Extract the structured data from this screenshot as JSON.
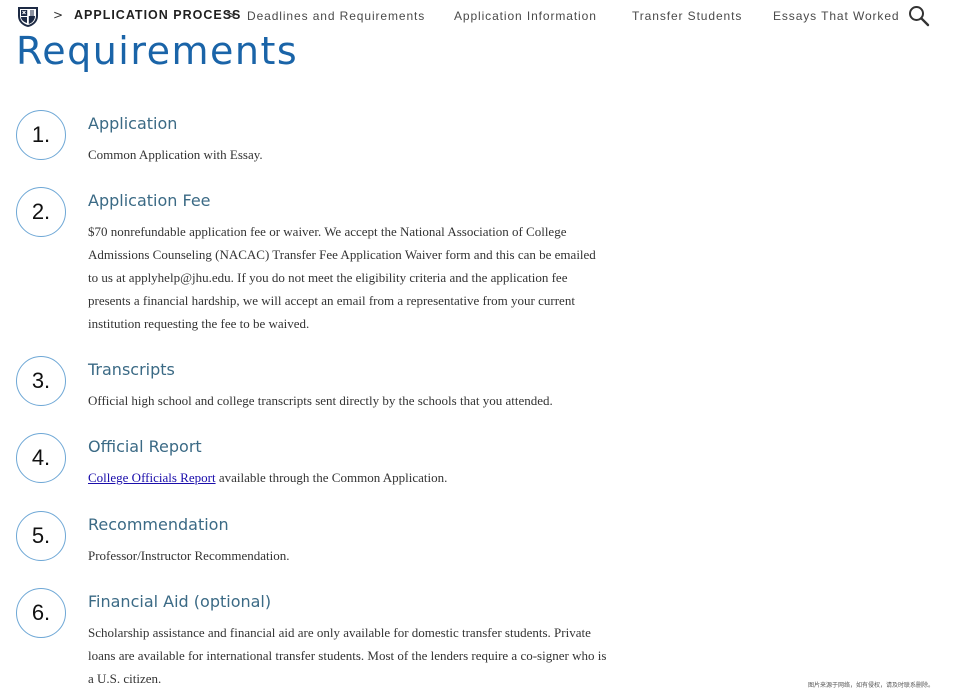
{
  "nav": {
    "current": "APPLICATION PROCESS",
    "links": [
      "Deadlines and Requirements",
      "Application Information",
      "Transfer Students",
      "Essays That Worked"
    ]
  },
  "page": {
    "title": "Requirements"
  },
  "steps": [
    {
      "number": "1.",
      "title": "Application",
      "body": "Common Application with Essay."
    },
    {
      "number": "2.",
      "title": "Application Fee",
      "body": "$70 nonrefundable application fee or waiver. We accept the National Association of College Admissions Counseling (NACAC) Transfer Fee Application Waiver form and this can be emailed to us at applyhelp@jhu.edu. If you do not meet the eligibility criteria and the application fee presents a financial hardship, we will accept an email from a representative from your current institution requesting the fee to be waived."
    },
    {
      "number": "3.",
      "title": "Transcripts",
      "body": "Official high school and college transcripts sent directly by the schools that you attended."
    },
    {
      "number": "4.",
      "title": "Official Report",
      "link": "College Officials Report",
      "body": " available through the Common Application."
    },
    {
      "number": "5.",
      "title": "Recommendation",
      "body": "Professor/Instructor Recommendation."
    },
    {
      "number": "6.",
      "title": "Financial Aid (optional)",
      "body": "Scholarship assistance and financial aid are only available for domestic transfer students. Private loans are available for international transfer students. Most of the lenders require a co-signer who is a U.S. citizen."
    }
  ],
  "watermark": "图片来源于网络，如有侵权，请及时联系删除。",
  "colors": {
    "title": "#1a64a8",
    "step_title": "#3b6a85",
    "circle_border": "#6fa8d6",
    "link": "#1a0dab"
  }
}
